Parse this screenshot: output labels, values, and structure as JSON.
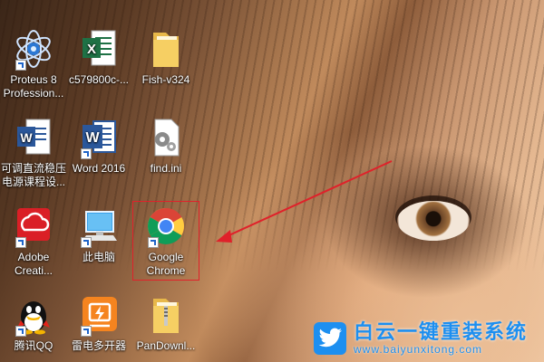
{
  "desktop": {
    "icons": [
      {
        "name": "proteus-icon",
        "label": "Proteus 8\nProfession..."
      },
      {
        "name": "excel-file-icon",
        "label": "c579800c-..."
      },
      {
        "name": "folder-icon",
        "label": "Fish-v324"
      },
      {
        "name": "word-doc-icon",
        "label": "可调直流稳压\n电源课程设..."
      },
      {
        "name": "word-app-icon",
        "label": "Word 2016"
      },
      {
        "name": "ini-file-icon",
        "label": "find.ini"
      },
      {
        "name": "adobe-cc-icon",
        "label": "Adobe\nCreati..."
      },
      {
        "name": "this-pc-icon",
        "label": "此电脑"
      },
      {
        "name": "chrome-icon",
        "label": "Google\nChrome"
      },
      {
        "name": "qq-icon",
        "label": "腾讯QQ"
      },
      {
        "name": "thunder-icon",
        "label": "雷电多开器"
      },
      {
        "name": "zip-folder-icon",
        "label": "PanDownl..."
      }
    ]
  },
  "annotation": {
    "highlight_color": "#e0212a",
    "arrow_color": "#e0212a"
  },
  "watermark": {
    "title": "白云一键重装系统",
    "url": "www.baiyunxitong.com",
    "color": "#1d8ff0"
  }
}
